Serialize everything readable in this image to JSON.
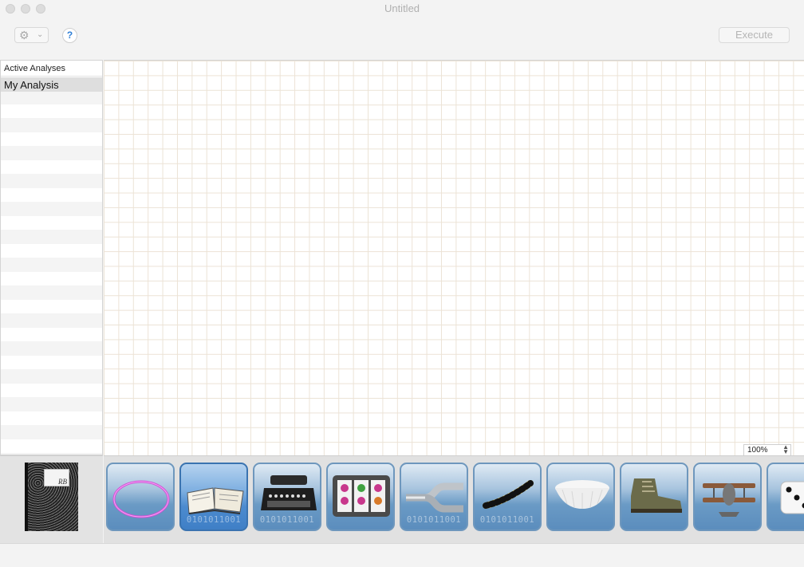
{
  "window": {
    "title": "Untitled"
  },
  "toolbar": {
    "help_label": "?",
    "execute_label": "Execute"
  },
  "sidebar": {
    "header": "Active Analyses",
    "items": [
      {
        "label": "My Analysis",
        "selected": true
      }
    ]
  },
  "canvas": {
    "zoom": "100%"
  },
  "notebook": {
    "label": "RB"
  },
  "palette": {
    "tiles": [
      {
        "icon": "ring-icon",
        "binary": ""
      },
      {
        "icon": "open-book-icon",
        "binary": "0101011001",
        "selected": true
      },
      {
        "icon": "typewriter-icon",
        "binary": "0101011001"
      },
      {
        "icon": "slot-machine-icon",
        "binary": ""
      },
      {
        "icon": "pipe-joint-icon",
        "binary": "0101011001"
      },
      {
        "icon": "caterpillar-icon",
        "binary": "0101011001"
      },
      {
        "icon": "coffee-filter-icon",
        "binary": ""
      },
      {
        "icon": "boot-icon",
        "binary": ""
      },
      {
        "icon": "biplane-icon",
        "binary": ""
      },
      {
        "icon": "dice-icon",
        "binary": ""
      }
    ]
  },
  "colors": {
    "tile_blue": "#6a9ac5",
    "selected_blue": "#4c8bcf",
    "grid": "#ece3d6",
    "help_blue": "#2f7fd6"
  }
}
